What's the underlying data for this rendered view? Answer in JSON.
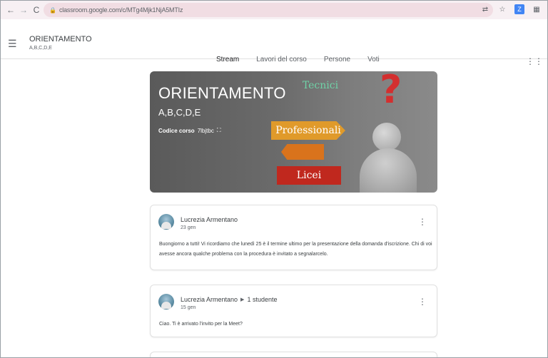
{
  "browser": {
    "url": "classroom.google.com/c/MTg4Mjk1NjA5MTIz",
    "back_icon": "arrow-left-icon",
    "forward_icon": "arrow-right-icon",
    "reload_icon": "reload-icon"
  },
  "header": {
    "class_title": "ORIENTAMENTO",
    "class_subtitle": "A,B,C,D,E",
    "tabs": [
      {
        "label": "Stream",
        "active": true
      },
      {
        "label": "Lavori del corso",
        "active": false
      },
      {
        "label": "Persone",
        "active": false
      },
      {
        "label": "Voti",
        "active": false
      }
    ]
  },
  "banner": {
    "title": "ORIENTAMENTO",
    "subtitle": "A,B,C,D,E",
    "code_label": "Codice corso",
    "code_value": "7lbjtbc",
    "signs": {
      "tecnici": "Tecnici",
      "professionali": "Professionali",
      "licei": "Licei"
    }
  },
  "posts": [
    {
      "author": "Lucrezia Armentano",
      "audience": "",
      "date": "23 gen",
      "text": "Buongiorno a tutti! Vi ricordiamo che lunedì 25 è il termine ultimo per la presentazione della domanda d'iscrizione. Chi di voi avesse ancora qualche problema con la procedura è invitato a segnalarcelo."
    },
    {
      "author": "Lucrezia Armentano",
      "audience": "1 studente",
      "date": "15 gen",
      "text": "Ciao. Ti è arrivato l'invito per la Meet?"
    }
  ],
  "colors": {
    "browser_bar": "#f7f0f3",
    "omnibox": "#f1dde3",
    "active_tab_indicator": "#202124",
    "question_mark": "#d32f2f"
  }
}
